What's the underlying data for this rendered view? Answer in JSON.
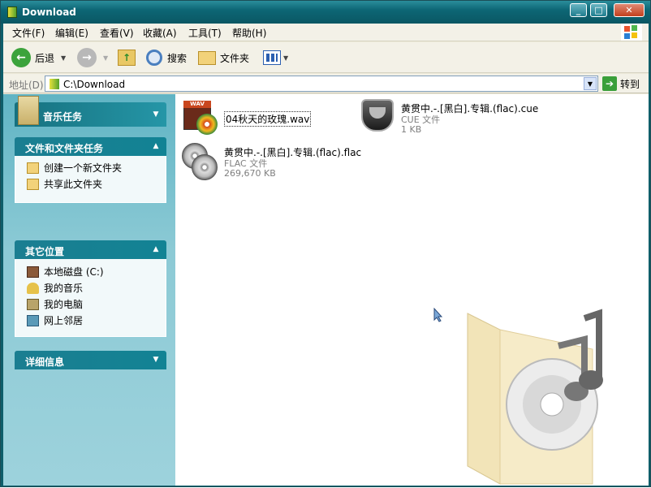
{
  "window": {
    "title": "Download"
  },
  "menu": [
    "文件(F)",
    "编辑(E)",
    "查看(V)",
    "收藏(A)",
    "工具(T)",
    "帮助(H)"
  ],
  "toolbar": {
    "back": "后退",
    "search": "搜索",
    "folders": "文件夹"
  },
  "address": {
    "label": "地址(D)",
    "path": "C:\\Download",
    "go": "转到"
  },
  "panels": {
    "music": {
      "title": "音乐任务"
    },
    "tasks": {
      "title": "文件和文件夹任务",
      "items": [
        "创建一个新文件夹",
        "共享此文件夹"
      ]
    },
    "places": {
      "title": "其它位置",
      "items": [
        "本地磁盘 (C:)",
        "我的音乐",
        "我的电脑",
        "网上邻居"
      ]
    },
    "details": {
      "title": "详细信息"
    }
  },
  "files": [
    {
      "name": "04秋天的玫瑰.wav",
      "type": "",
      "size": "",
      "icon": "wav-file-icon"
    },
    {
      "name": "黄贯中.-.[黑白].专辑.(flac).cue",
      "type": "CUE 文件",
      "size": "1 KB",
      "icon": "cue-file-icon"
    },
    {
      "name": "黄贯中.-.[黑白].专辑.(flac).flac",
      "type": "FLAC 文件",
      "size": "269,670 KB",
      "icon": "flac-file-icon"
    }
  ],
  "colors": {
    "title_bar": "#0d6675",
    "task_pane": "#8ccad5",
    "panel_header": "#1b7e91"
  }
}
